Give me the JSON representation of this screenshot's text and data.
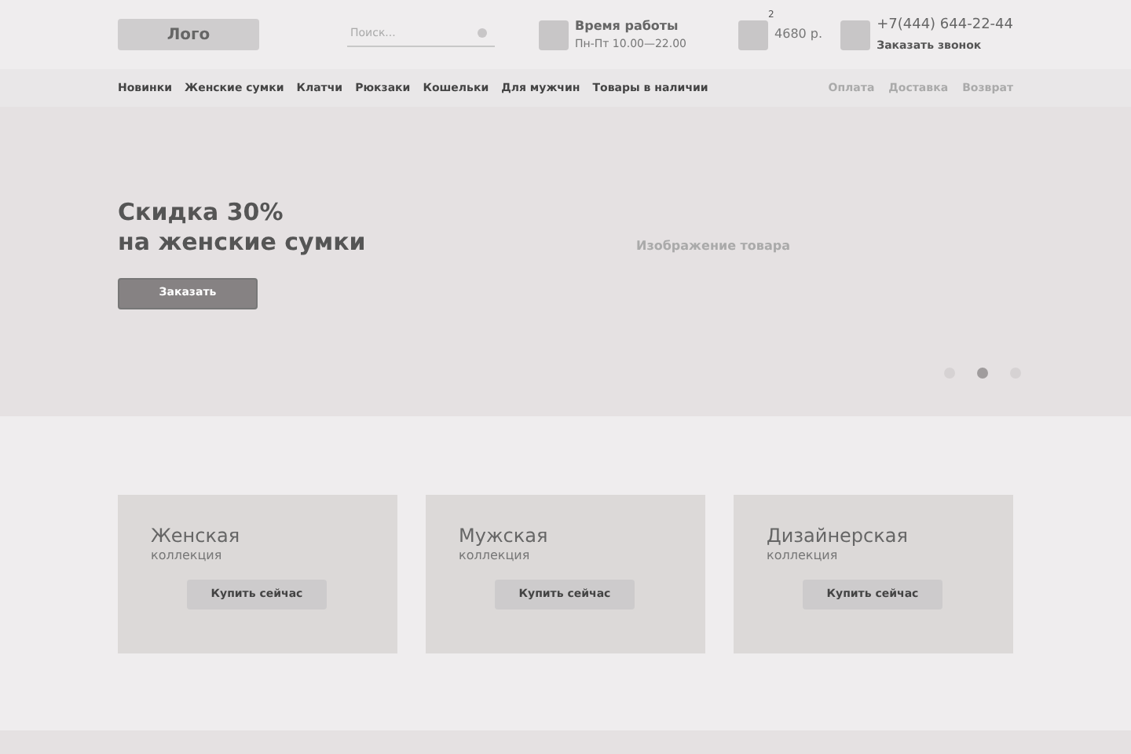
{
  "logo": "Лого",
  "search": {
    "placeholder": "Поиск..."
  },
  "hours": {
    "title": "Время работы",
    "text": "Пн-Пт 10.00—22.00"
  },
  "cart": {
    "count": "2",
    "total": "4680 р."
  },
  "phone": {
    "number": "+7(444) 644-22-44",
    "link": "Заказать звонок"
  },
  "nav": [
    "Новинки",
    "Женские сумки",
    "Клатчи",
    "Рюкзаки",
    "Кошельки",
    "Для мужчин",
    "Товары в наличии"
  ],
  "nav_secondary": [
    "Оплата",
    "Доставка",
    "Возврат"
  ],
  "hero": {
    "title_lines": [
      "Скидка 30%",
      "на женские сумки"
    ],
    "button": "Заказать",
    "image_label": "Изображение товара",
    "dots": [
      {
        "selected": false
      },
      {
        "selected": true
      },
      {
        "selected": false
      }
    ]
  },
  "collections": [
    {
      "title": "Женская",
      "subtitle": "коллекция",
      "button": "Купить сейчас"
    },
    {
      "title": "Мужская",
      "subtitle": "коллекция",
      "button": "Купить сейчас"
    },
    {
      "title": "Дизайнерская",
      "subtitle": "коллекция",
      "button": "Купить сейчас"
    }
  ]
}
